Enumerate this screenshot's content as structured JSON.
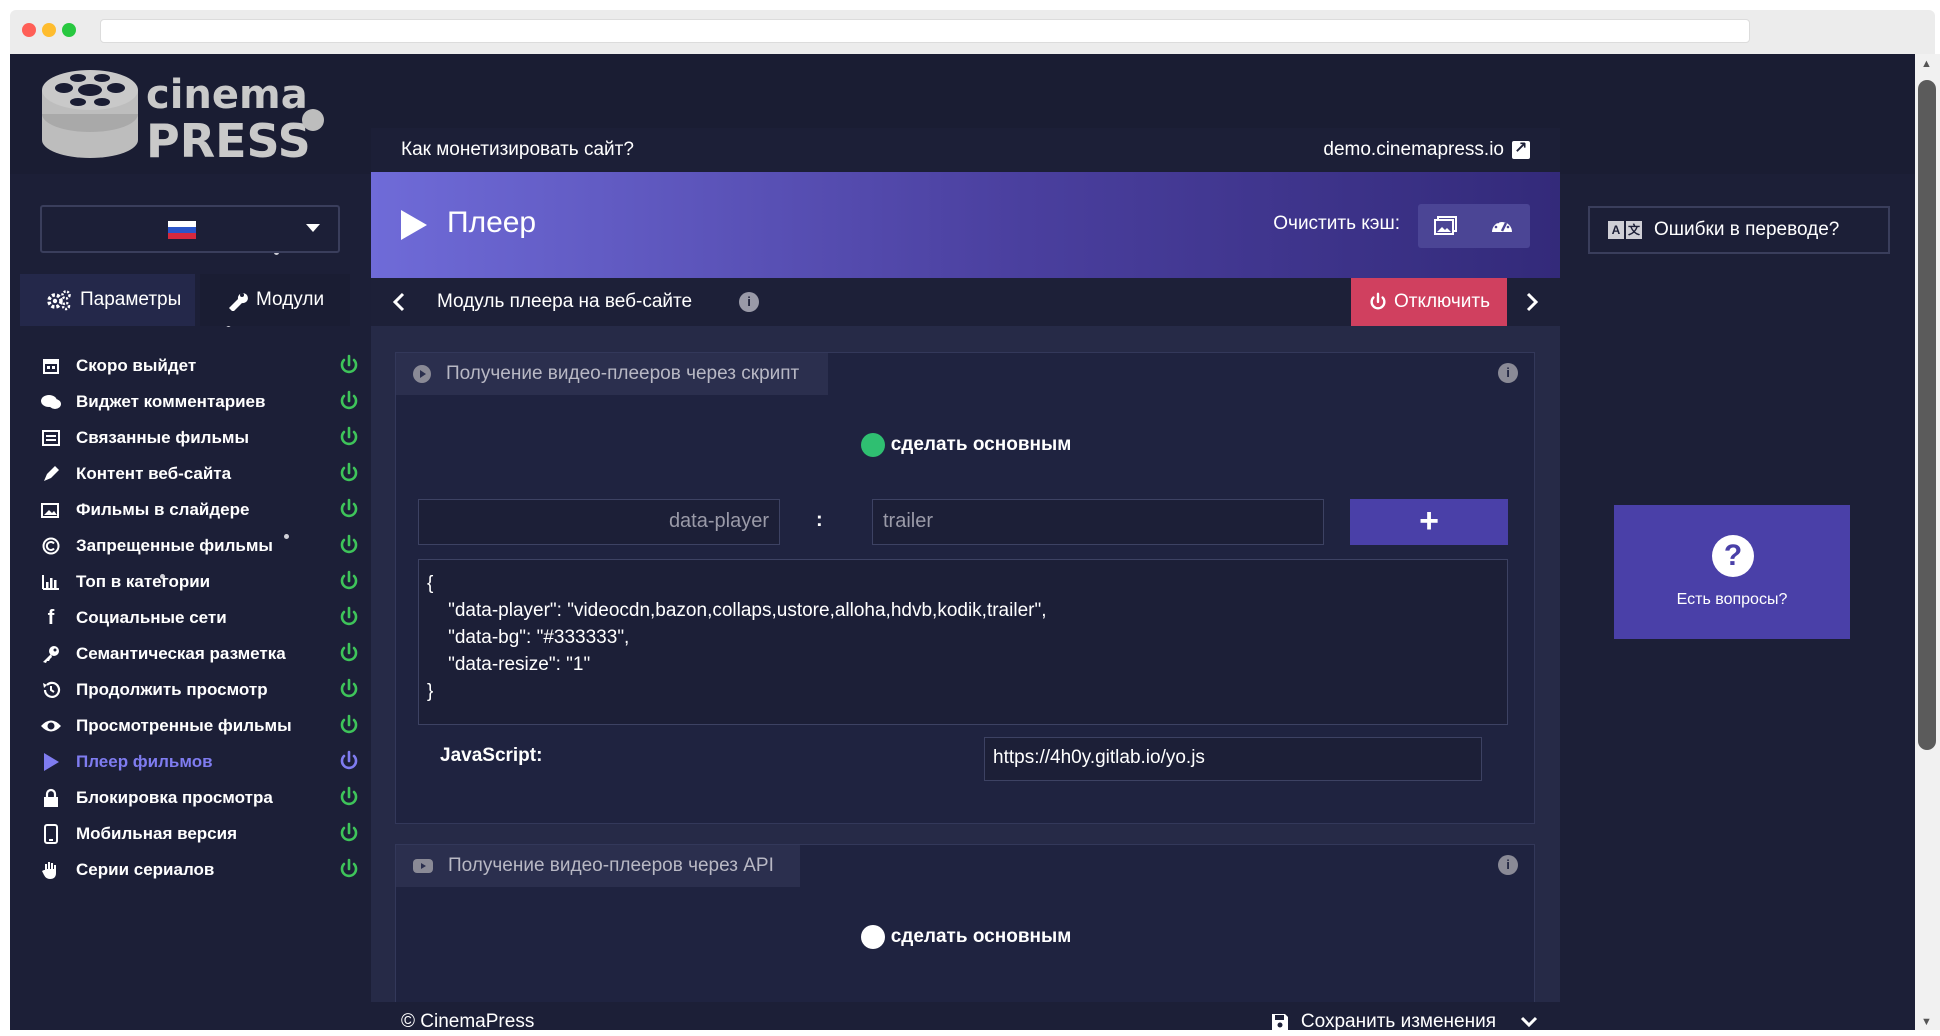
{
  "header": {
    "logo_line1": "cinema",
    "logo_line2": "PRESS",
    "monetize_link": "Как монетизировать сайт?",
    "site_link": "demo.cinemapress.io"
  },
  "sidebar": {
    "language_flag": "ru-flag",
    "tabs": [
      {
        "label": "Параметры",
        "icon": "gears-icon"
      },
      {
        "label": "Модули",
        "icon": "wrench-icon"
      }
    ],
    "items": [
      {
        "label": "Скоро выйдет",
        "icon": "calendar-icon",
        "enabled": true
      },
      {
        "label": "Виджет комментариев",
        "icon": "comments-icon",
        "enabled": true
      },
      {
        "label": "Связанные фильмы",
        "icon": "list-icon",
        "enabled": true
      },
      {
        "label": "Контент веб-сайта",
        "icon": "pen-icon",
        "enabled": true
      },
      {
        "label": "Фильмы в слайдере",
        "icon": "images-icon",
        "enabled": true
      },
      {
        "label": "Запрещенные фильмы",
        "icon": "copyright-icon",
        "enabled": true
      },
      {
        "label": "Топ в категории",
        "icon": "bar-chart-icon",
        "enabled": true
      },
      {
        "label": "Социальные сети",
        "icon": "facebook-icon",
        "enabled": true
      },
      {
        "label": "Семантическая разметка",
        "icon": "key-icon",
        "enabled": true
      },
      {
        "label": "Продолжить просмотр",
        "icon": "history-icon",
        "enabled": true
      },
      {
        "label": "Просмотренные фильмы",
        "icon": "eye-icon",
        "enabled": true
      },
      {
        "label": "Плеер фильмов",
        "icon": "play-icon",
        "enabled": true,
        "active": true
      },
      {
        "label": "Блокировка просмотра",
        "icon": "lock-icon",
        "enabled": true
      },
      {
        "label": "Мобильная версия",
        "icon": "mobile-icon",
        "enabled": true
      },
      {
        "label": "Серии сериалов",
        "icon": "hand-icon",
        "enabled": true
      }
    ]
  },
  "hero": {
    "title": "Плеер",
    "cache_label": "Очистить кэш:"
  },
  "module_bar": {
    "title": "Модуль плеера на веб-сайте",
    "disable_label": "Отключить"
  },
  "script_card": {
    "title": "Получение видео-плееров через скрипт",
    "make_primary": "сделать основным",
    "key_placeholder": "data-player",
    "value_placeholder": "trailer",
    "add_label": "+",
    "json_text": "{\n    \"data-player\": \"videocdn,bazon,collaps,ustore,alloha,hdvb,kodik,trailer\",\n    \"data-bg\": \"#333333\",\n    \"data-resize\": \"1\"\n}",
    "js_label": "JavaScript:",
    "js_value": "https://4h0y.gitlab.io/yo.js"
  },
  "api_card": {
    "title": "Получение видео-плееров через API",
    "make_primary": "сделать основным"
  },
  "footer": {
    "copyright": "© CinemaPress",
    "save_label": "Сохранить изменения"
  },
  "right": {
    "translate_label": "Ошибки в переводе?",
    "help_label": "Есть вопросы?"
  },
  "colors": {
    "background": "#1c1f37",
    "accent": "#4a40a8",
    "hero_gradient_start": "#6f6bd8",
    "disable": "#d0405f",
    "enabled_green": "#3ec45a",
    "primary_radio_on": "#2fbf71",
    "active_item": "#7f7cf0"
  }
}
